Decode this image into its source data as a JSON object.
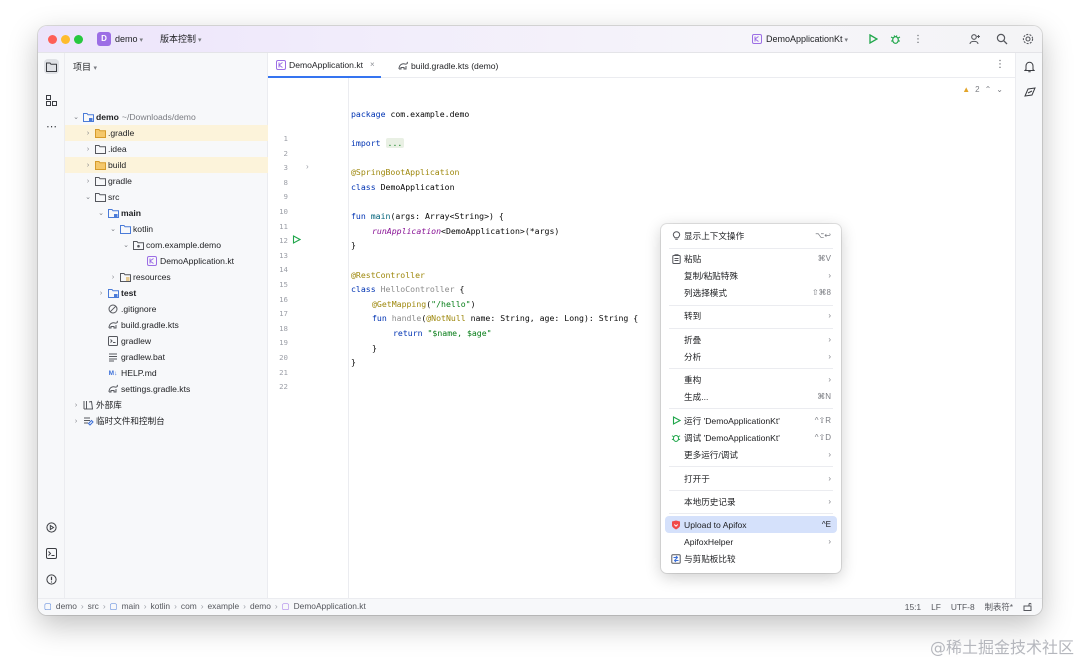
{
  "titlebar": {
    "project_letter": "D",
    "project_name": "demo",
    "vcs_label": "版本控制",
    "run_config": "DemoApplicationKt"
  },
  "project_panel": {
    "header": "项目",
    "root_name": "demo",
    "root_path": "~/Downloads/demo",
    "items": [
      {
        "label": ".gradle"
      },
      {
        "label": ".idea"
      },
      {
        "label": "build"
      },
      {
        "label": "gradle"
      },
      {
        "label": "src"
      },
      {
        "label": "main"
      },
      {
        "label": "kotlin"
      },
      {
        "label": "com.example.demo"
      },
      {
        "label": "DemoApplication.kt"
      },
      {
        "label": "resources"
      },
      {
        "label": "test"
      },
      {
        "label": ".gitignore"
      },
      {
        "label": "build.gradle.kts"
      },
      {
        "label": "gradlew"
      },
      {
        "label": "gradlew.bat"
      },
      {
        "label": "HELP.md"
      },
      {
        "label": "settings.gradle.kts"
      },
      {
        "label": "外部库"
      },
      {
        "label": "临时文件和控制台"
      }
    ]
  },
  "editor": {
    "tabs": [
      {
        "label": "DemoApplication.kt"
      },
      {
        "label": "build.gradle.kts (demo)"
      }
    ],
    "warning_count": "2",
    "line_numbers": [
      "1",
      "2",
      "3",
      "8",
      "9",
      "10",
      "11",
      "12",
      "13",
      "14",
      "15",
      "16",
      "17",
      "18",
      "19",
      "20",
      "21",
      "22"
    ],
    "code": {
      "l1_kw": "package",
      "l1_rest": " com.example.demo",
      "l3_kw": "import",
      "l3_fold": "...",
      "l9": "@SpringBootApplication",
      "l10_kw": "class",
      "l10_rest": " DemoApplication",
      "l12_kw": "fun",
      "l12_fn": " main",
      "l12_rest": "(args: Array<String>) {",
      "l13_fn": "runApplication",
      "l13_rest": "<DemoApplication>(*args)",
      "l14": "}",
      "l16": "@RestController",
      "l17_kw": "class",
      "l17_name": " HelloController",
      "l17_rest": " {",
      "l18_ann": "@GetMapping",
      "l18_p1": "(",
      "l18_str": "\"/hello\"",
      "l18_p2": ")",
      "l19_kw": "fun",
      "l19_fn": " handle",
      "l19_p1": "(",
      "l19_ann": "@NotNull",
      "l19_rest": " name: String, age: Long): String {",
      "l20_kw": "return",
      "l20_str": " \"$name, $age\"",
      "l21": "}",
      "l22": "}"
    }
  },
  "context_menu": {
    "items": [
      {
        "label": "显示上下文操作",
        "shortcut": "⌥↩"
      },
      {
        "label": "粘贴",
        "shortcut": "⌘V"
      },
      {
        "label": "复制/粘贴特殊",
        "shortcut": "›"
      },
      {
        "label": "列选择模式",
        "shortcut": "⇧⌘8"
      },
      {
        "label": "转到",
        "shortcut": "›"
      },
      {
        "label": "折叠",
        "shortcut": "›"
      },
      {
        "label": "分析",
        "shortcut": "›"
      },
      {
        "label": "重构",
        "shortcut": "›"
      },
      {
        "label": "生成...",
        "shortcut": "⌘N"
      },
      {
        "label": "运行 'DemoApplicationKt'",
        "shortcut": "^⇧R"
      },
      {
        "label": "调试 'DemoApplicationKt'",
        "shortcut": "^⇧D"
      },
      {
        "label": "更多运行/调试",
        "shortcut": "›"
      },
      {
        "label": "打开于",
        "shortcut": "›"
      },
      {
        "label": "本地历史记录",
        "shortcut": "›"
      },
      {
        "label": "Upload to Apifox",
        "shortcut": "^E"
      },
      {
        "label": "ApifoxHelper",
        "shortcut": "›"
      },
      {
        "label": "与剪贴板比较",
        "shortcut": ""
      }
    ]
  },
  "statusbar": {
    "breadcrumb": [
      "demo",
      "src",
      "main",
      "kotlin",
      "com",
      "example",
      "demo",
      "DemoApplication.kt"
    ],
    "position": "15:1",
    "line_ending": "LF",
    "encoding": "UTF-8",
    "indent": "制表符*"
  },
  "watermark": "@稀土掘金技术社区",
  "colors": {
    "accent": "#3574f0",
    "highlight_folder": "#fcf3da",
    "menu_selected": "#d5e1fb",
    "apifox": "#f04a4a"
  }
}
